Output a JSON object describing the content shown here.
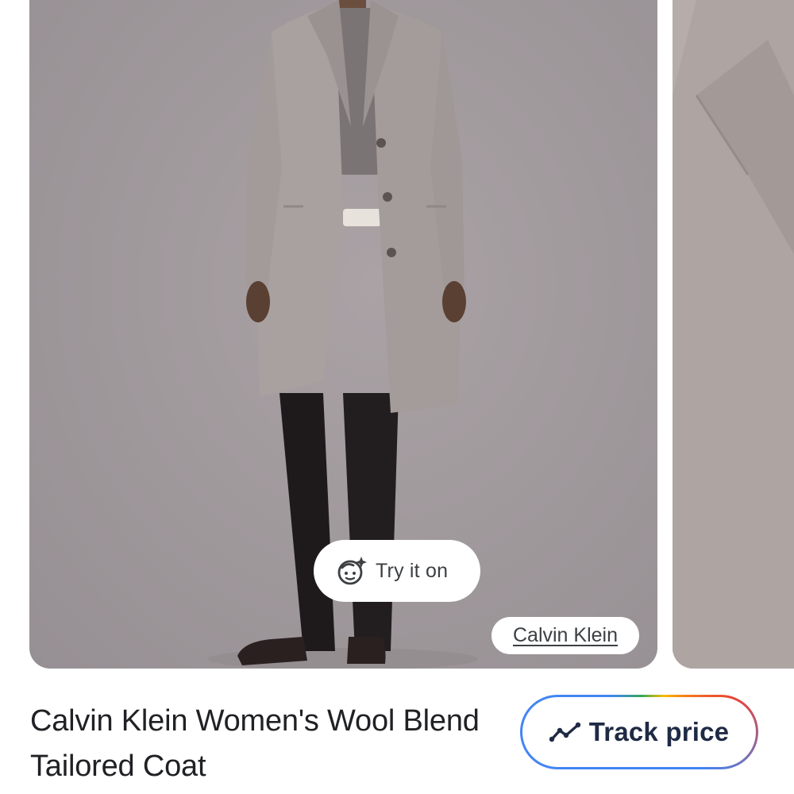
{
  "product": {
    "title": "Calvin Klein Women's Wool Blend Tailored Coat",
    "brand": "Calvin Klein"
  },
  "carousel": {
    "images": [
      {
        "subject": "model wearing grey wool tailored coat"
      },
      {
        "subject": "close-up of coat fabric and lapel"
      }
    ]
  },
  "try_on": {
    "label": "Try it on",
    "icon": "face-sparkle-icon"
  },
  "track_price": {
    "label": "Track price",
    "icon": "trending-up-icon"
  },
  "colors": {
    "background": "#ffffff",
    "text": "#202124",
    "chip_text": "#3c4043",
    "track_label": "#1f2a44",
    "coat_grey": "#a8a09d",
    "backdrop": "#a19a9d"
  }
}
